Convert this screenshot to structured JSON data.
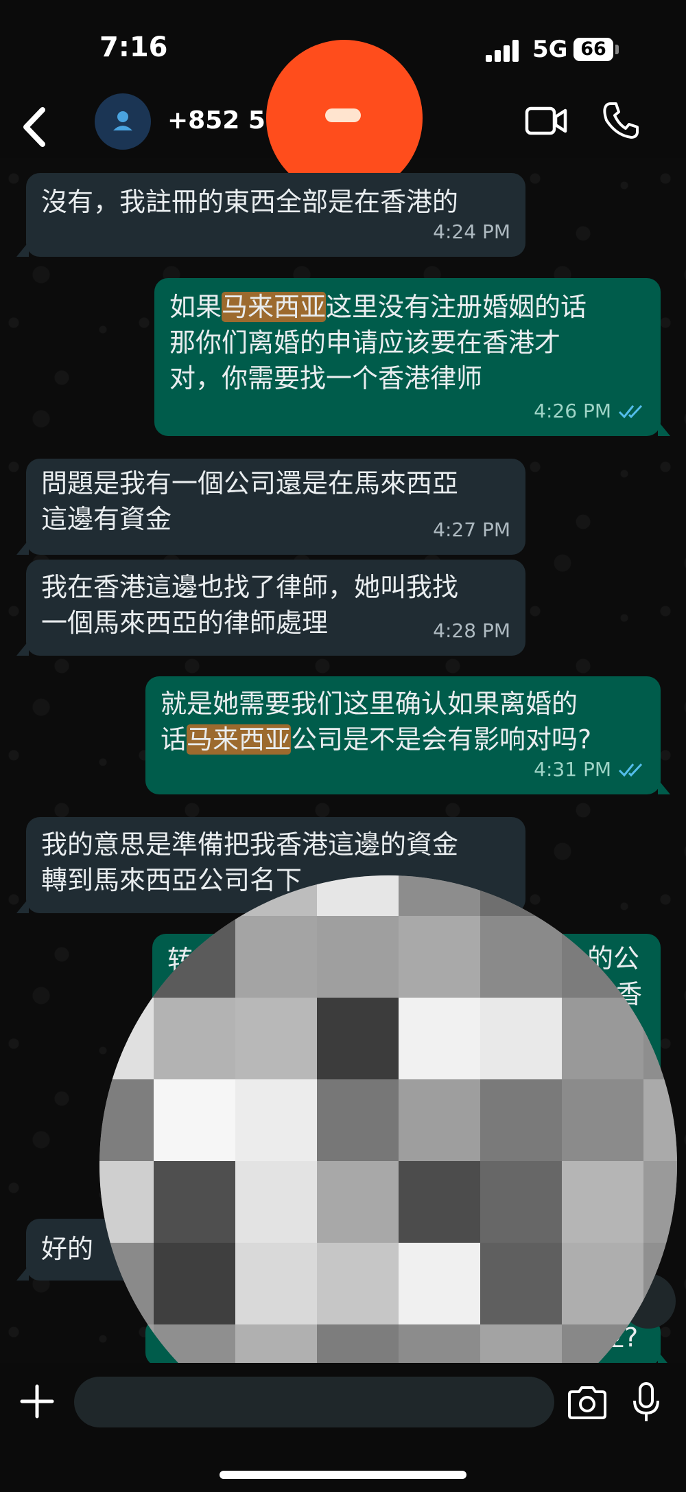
{
  "status_bar": {
    "time": "7:16",
    "network": "5G",
    "battery": "66"
  },
  "header": {
    "contact": "+852 53"
  },
  "messages": [
    {
      "dir": "in",
      "lines": [
        "沒有，我註冊的東西全部是在香港的"
      ],
      "time": "4:24 PM"
    },
    {
      "dir": "out",
      "lines": [
        "如果",
        "马来西亚",
        "这里没有注册婚姻的话",
        "那你们离婚的申请应该要在香港才",
        "对，你需要找一个香港律师"
      ],
      "time": "4:26 PM"
    },
    {
      "dir": "in",
      "lines": [
        "問題是我有一個公司還是在馬來西亞",
        "這邊有資金"
      ],
      "time": "4:27 PM"
    },
    {
      "dir": "in",
      "lines": [
        "我在香港這邊也找了律師，她叫我找",
        "一個馬來西亞的律師處理"
      ],
      "time": "4:28 PM"
    },
    {
      "dir": "out",
      "lines": [
        "就是她需要我们这里确认如果离婚的",
        "话",
        "马来西亚",
        "公司是不是会有影响对吗?"
      ],
      "time": "4:31 PM"
    },
    {
      "dir": "in",
      "lines": [
        "我的意思是準備把我香港這邊的資金",
        "轉到馬來西亞公司名下"
      ],
      "time": ""
    },
    {
      "dir": "out",
      "lines": [
        "转",
        "的公",
        "香"
      ],
      "time": ""
    },
    {
      "dir": "in",
      "lines": [
        "好的"
      ],
      "time": ""
    },
    {
      "dir": "out",
      "lines": [
        "亚?"
      ],
      "time": ""
    }
  ],
  "colors": {
    "incoming": "#202c33",
    "outgoing": "#005c4b",
    "highlight": "#9c6a2e",
    "record": "#ff4d1c"
  }
}
